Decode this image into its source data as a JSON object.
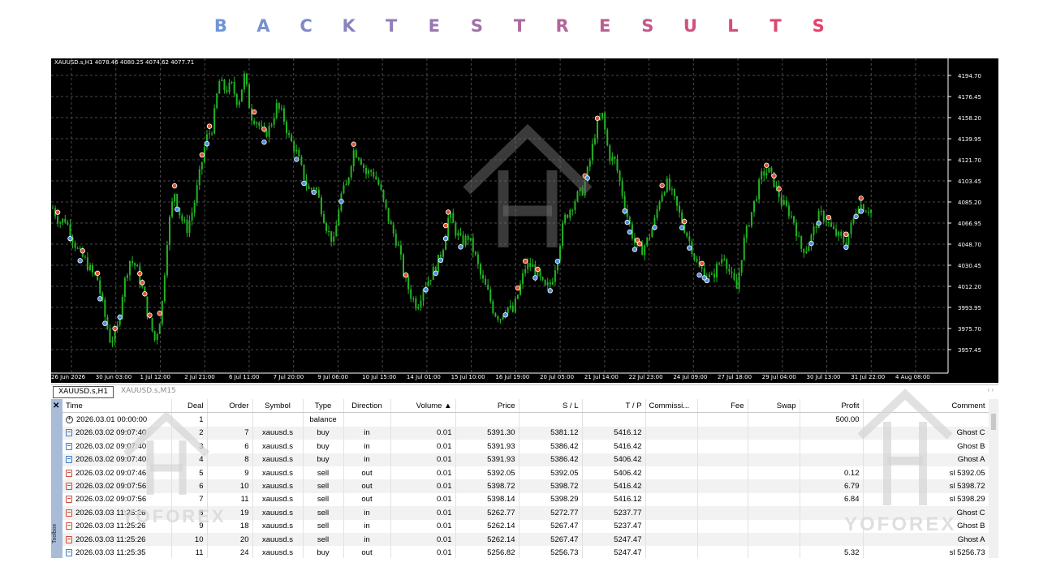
{
  "banner": {
    "letters": [
      "B",
      "A",
      "C",
      "K",
      "T",
      "E",
      "S",
      "T",
      "R",
      "E",
      "S",
      "U",
      "L",
      "T",
      "S"
    ]
  },
  "chart": {
    "info": "XAUUSD.s,H1  4078.46 4080.25 4074.62 4077.71",
    "price_labels": [
      "4194.70",
      "4176.45",
      "4158.20",
      "4139.95",
      "4121.70",
      "4103.45",
      "4085.20",
      "4066.95",
      "4048.70",
      "4030.45",
      "4012.20",
      "3993.95",
      "3975.70",
      "3957.45"
    ],
    "time_labels": [
      "26 Jun 2026",
      "30 Jun 03:00",
      "1 Jul 12:00",
      "2 Jul 21:00",
      "6 Jul 11:00",
      "7 Jul 20:00",
      "9 Jul 06:00",
      "10 Jul 15:00",
      "14 Jul 01:00",
      "15 Jul 10:00",
      "16 Jul 19:00",
      "20 Jul 05:00",
      "21 Jul 14:00",
      "22 Jul 23:00",
      "24 Jul 09:00",
      "27 Jul 18:00",
      "29 Jul 04:00",
      "30 Jul 13:00",
      "31 Jul 22:00",
      "4 Aug 08:00"
    ],
    "series": [
      4080,
      4068,
      4070,
      4055,
      4042,
      4035,
      4025,
      4018,
      3990,
      3965,
      3972,
      4010,
      4035,
      4030,
      4010,
      3985,
      3965,
      3990,
      4060,
      4095,
      4072,
      4062,
      4080,
      4110,
      4140,
      4150,
      4190,
      4182,
      4186,
      4170,
      4195,
      4160,
      4155,
      4142,
      4150,
      4168,
      4160,
      4140,
      4130,
      4112,
      4095,
      4100,
      4080,
      4060,
      4050,
      4090,
      4100,
      4130,
      4125,
      4110,
      4112,
      4100,
      4080,
      4062,
      4048,
      4020,
      4005,
      3995,
      4012,
      4020,
      4030,
      4045,
      4075,
      4060,
      4050,
      4055,
      4040,
      4020,
      4008,
      3990,
      3985,
      3995,
      3990,
      4010,
      4030,
      4030,
      4020,
      4010,
      4015,
      4040,
      4070,
      4080,
      4090,
      4096,
      4120,
      4150,
      4160,
      4125,
      4120,
      4095,
      4070,
      4050,
      4042,
      4052,
      4065,
      4090,
      4102,
      4090,
      4075,
      4060,
      4045,
      4028,
      4025,
      4018,
      4030,
      4040,
      4022,
      4010,
      4048,
      4070,
      4090,
      4110,
      4112,
      4100,
      4085,
      4078,
      4068,
      4045,
      4045,
      4060,
      4075,
      4070,
      4060,
      4055,
      4050,
      4065,
      4085,
      4080,
      4078
    ]
  },
  "tabs": [
    "XAUUSD.s,H1",
    "XAUUSD.s,M15"
  ],
  "tab_arrows": "‹  ›",
  "toolbox": {
    "label": "Toolbox",
    "close": "✕"
  },
  "table": {
    "columns": [
      "Time",
      "Deal",
      "Order",
      "Symbol",
      "Type",
      "Direction",
      "Volume  ▲",
      "Price",
      "S / L",
      "T / P",
      "Commissi...",
      "Fee",
      "Swap",
      "Profit",
      "Comment"
    ],
    "rows": [
      {
        "icon": "balance",
        "time": "2026.03.01 00:00:00",
        "deal": "1",
        "order": "",
        "symbol": "",
        "type": "balance",
        "direction": "",
        "volume": "",
        "price": "",
        "sl": "",
        "tp": "",
        "commission": "",
        "fee": "",
        "swap": "",
        "profit": "500.00",
        "comment": ""
      },
      {
        "icon": "buy",
        "time": "2026.03.02 09:07:40",
        "deal": "2",
        "order": "7",
        "symbol": "xauusd.s",
        "type": "buy",
        "direction": "in",
        "volume": "0.01",
        "price": "5391.30",
        "sl": "5381.12",
        "tp": "5416.12",
        "commission": "",
        "fee": "",
        "swap": "",
        "profit": "",
        "comment": "Ghost C"
      },
      {
        "icon": "buy",
        "time": "2026.03.02 09:07:40",
        "deal": "3",
        "order": "6",
        "symbol": "xauusd.s",
        "type": "buy",
        "direction": "in",
        "volume": "0.01",
        "price": "5391.93",
        "sl": "5386.42",
        "tp": "5416.42",
        "commission": "",
        "fee": "",
        "swap": "",
        "profit": "",
        "comment": "Ghost B"
      },
      {
        "icon": "buy",
        "time": "2026.03.02 09:07:40",
        "deal": "4",
        "order": "8",
        "symbol": "xauusd.s",
        "type": "buy",
        "direction": "in",
        "volume": "0.01",
        "price": "5391.93",
        "sl": "5386.42",
        "tp": "5406.42",
        "commission": "",
        "fee": "",
        "swap": "",
        "profit": "",
        "comment": "Ghost A"
      },
      {
        "icon": "sell",
        "time": "2026.03.02 09:07:46",
        "deal": "5",
        "order": "9",
        "symbol": "xauusd.s",
        "type": "sell",
        "direction": "out",
        "volume": "0.01",
        "price": "5392.05",
        "sl": "5392.05",
        "tp": "5406.42",
        "commission": "",
        "fee": "",
        "swap": "",
        "profit": "0.12",
        "comment": "sl 5392.05"
      },
      {
        "icon": "sell",
        "time": "2026.03.02 09:07:56",
        "deal": "6",
        "order": "10",
        "symbol": "xauusd.s",
        "type": "sell",
        "direction": "out",
        "volume": "0.01",
        "price": "5398.72",
        "sl": "5398.72",
        "tp": "5416.42",
        "commission": "",
        "fee": "",
        "swap": "",
        "profit": "6.79",
        "comment": "sl 5398.72"
      },
      {
        "icon": "sell",
        "time": "2026.03.02 09:07:56",
        "deal": "7",
        "order": "11",
        "symbol": "xauusd.s",
        "type": "sell",
        "direction": "out",
        "volume": "0.01",
        "price": "5398.14",
        "sl": "5398.29",
        "tp": "5416.12",
        "commission": "",
        "fee": "",
        "swap": "",
        "profit": "6.84",
        "comment": "sl 5398.29"
      },
      {
        "icon": "sell",
        "time": "2026.03.03 11:25:26",
        "deal": "8",
        "order": "19",
        "symbol": "xauusd.s",
        "type": "sell",
        "direction": "in",
        "volume": "0.01",
        "price": "5262.77",
        "sl": "5272.77",
        "tp": "5237.77",
        "commission": "",
        "fee": "",
        "swap": "",
        "profit": "",
        "comment": "Ghost C"
      },
      {
        "icon": "sell",
        "time": "2026.03.03 11:25:26",
        "deal": "9",
        "order": "18",
        "symbol": "xauusd.s",
        "type": "sell",
        "direction": "in",
        "volume": "0.01",
        "price": "5262.14",
        "sl": "5267.47",
        "tp": "5237.47",
        "commission": "",
        "fee": "",
        "swap": "",
        "profit": "",
        "comment": "Ghost B"
      },
      {
        "icon": "sell",
        "time": "2026.03.03 11:25:26",
        "deal": "10",
        "order": "20",
        "symbol": "xauusd.s",
        "type": "sell",
        "direction": "in",
        "volume": "0.01",
        "price": "5262.14",
        "sl": "5267.47",
        "tp": "5247.47",
        "commission": "",
        "fee": "",
        "swap": "",
        "profit": "",
        "comment": "Ghost A"
      },
      {
        "icon": "buy",
        "time": "2026.03.03 11:25:35",
        "deal": "11",
        "order": "24",
        "symbol": "xauusd.s",
        "type": "buy",
        "direction": "out",
        "volume": "0.01",
        "price": "5256.82",
        "sl": "5256.73",
        "tp": "5247.47",
        "commission": "",
        "fee": "",
        "swap": "",
        "profit": "5.32",
        "comment": "sl 5256.73"
      }
    ]
  },
  "watermark": {
    "text": "YOFOREX"
  },
  "colors": {
    "candle": "#22b422",
    "background": "#000000",
    "grid": "#5a5a5a",
    "buy_marker": "#4a90e2",
    "sell_marker": "#e0532f",
    "banner_from": "#6f95d8",
    "banner_to": "#e6406a"
  }
}
